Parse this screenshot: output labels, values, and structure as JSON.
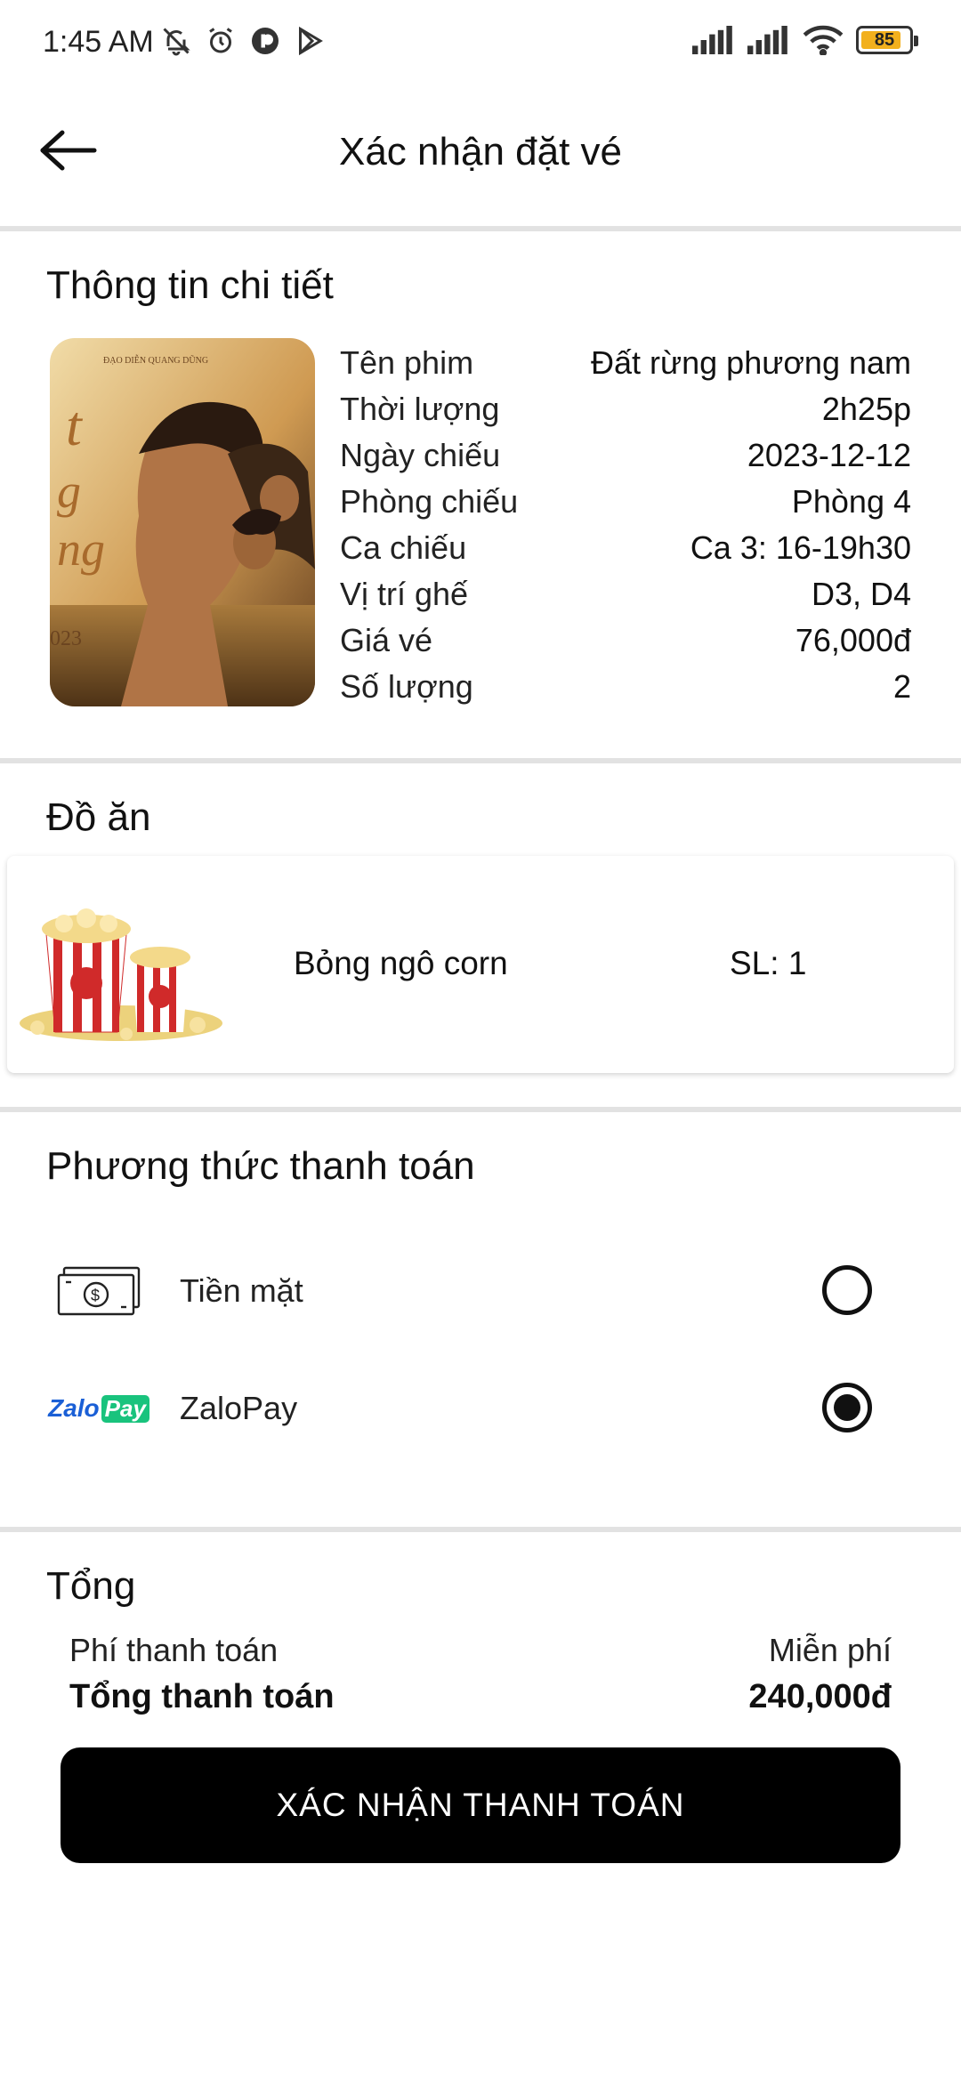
{
  "status_bar": {
    "time": "1:45 AM",
    "battery_level": 85,
    "battery_text": "85"
  },
  "header": {
    "title": "Xác nhận đặt vé"
  },
  "details": {
    "section_title": "Thông tin chi tiết",
    "rows": [
      {
        "label": "Tên phim",
        "value": "Đất rừng phương nam"
      },
      {
        "label": "Thời lượng",
        "value": "2h25p"
      },
      {
        "label": "Ngày chiếu",
        "value": "2023-12-12"
      },
      {
        "label": "Phòng chiếu",
        "value": "Phòng 4"
      },
      {
        "label": "Ca chiếu",
        "value": "Ca 3: 16-19h30"
      },
      {
        "label": "Vị trí ghế",
        "value": "D3, D4"
      },
      {
        "label": "Giá vé",
        "value": "76,000đ"
      },
      {
        "label": "Số lượng",
        "value": "2"
      }
    ]
  },
  "food": {
    "section_title": "Đồ ăn",
    "item_name": "Bỏng ngô corn",
    "quantity": "SL: 1"
  },
  "payment": {
    "section_title": "Phương thức thanh toán",
    "options": [
      {
        "label": "Tiền mặt",
        "icon": "cash-icon",
        "selected": false
      },
      {
        "label": "ZaloPay",
        "icon": "zalopay-logo",
        "selected": true
      }
    ],
    "zalopay_logo_text_a": "Zalo",
    "zalopay_logo_text_b": "Pay"
  },
  "totals": {
    "section_title": "Tổng",
    "fee_label": "Phí thanh toán",
    "fee_value": "Miễn phí",
    "total_label": "Tổng thanh toán",
    "total_value": "240,000đ"
  },
  "confirm_button": "XÁC NHẬN THANH TOÁN",
  "colors": {
    "button_bg": "#000000",
    "divider": "#e2e2e2",
    "zalopay_blue": "#1a5fd6",
    "zalopay_green": "#19c37d",
    "battery": "#f2b01e"
  }
}
